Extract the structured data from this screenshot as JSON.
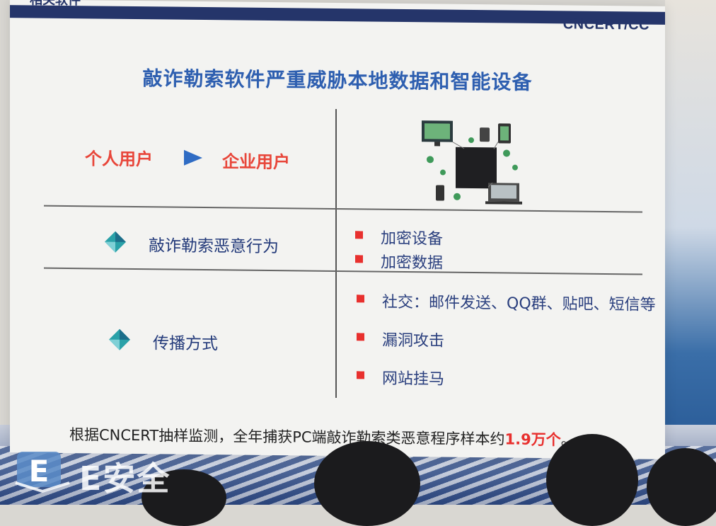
{
  "slide": {
    "header_text": "相关软件",
    "logo": "CNCERT/CC",
    "title": "敲诈勒索软件严重威胁本地数据和智能设备",
    "flow": {
      "from": "个人用户",
      "to": "企业用户"
    },
    "rows": [
      {
        "label": "敲诈勒索恶意行为",
        "items": [
          "加密设备",
          "加密数据"
        ]
      },
      {
        "label": "传播方式",
        "items": [
          "社交：邮件发送、QQ群、贴吧、短信等",
          "漏洞攻击",
          "网站挂马"
        ]
      }
    ],
    "footer_prefix": "根据CNCERT抽样监测，全年捕获PC端敲诈勒索类恶意程序样本约",
    "footer_highlight": "1.9万个",
    "footer_suffix": "。"
  },
  "watermark": {
    "letter": "E",
    "text": "E安全"
  },
  "colors": {
    "title": "#2e5fb0",
    "accent_red": "#e8302e",
    "navy": "#25356a",
    "arrow": "#2f6cc4"
  }
}
